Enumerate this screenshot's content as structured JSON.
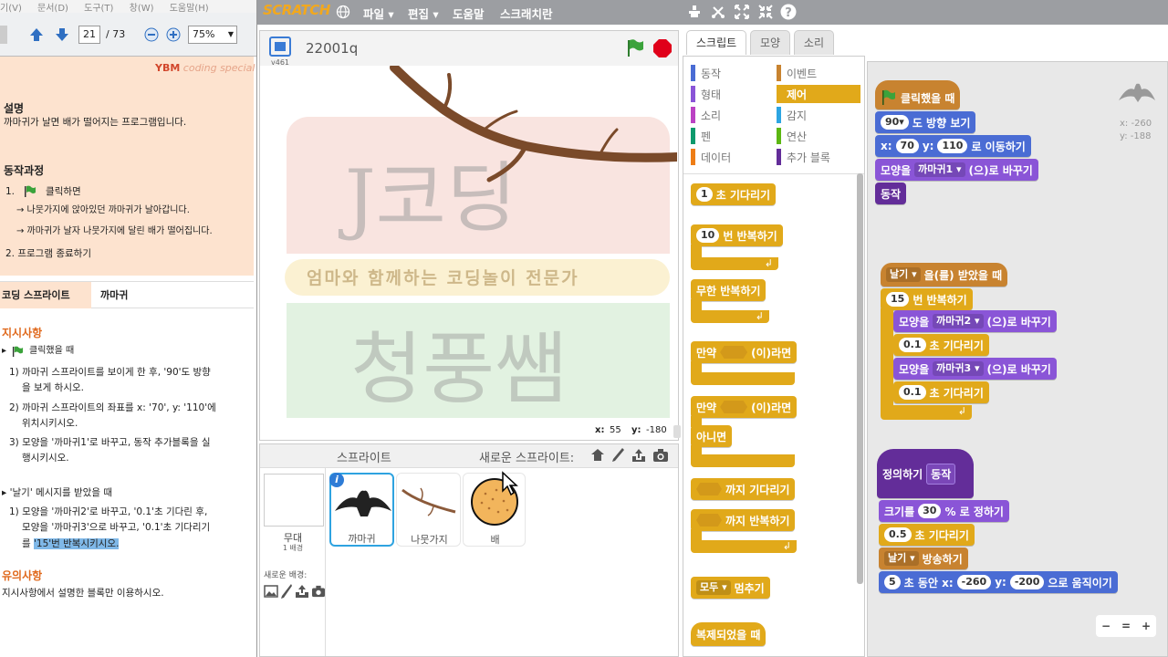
{
  "pdf": {
    "menu": [
      "기(V)",
      "문서(D)",
      "도구(T)",
      "창(W)",
      "도움말(H)"
    ],
    "page_current": "21",
    "page_total": "/ 73",
    "zoom": "75%",
    "logo_text": "coding special",
    "desc_title": "설명",
    "desc_text": "까마귀가 날면 배가 떨어지는 프로그램입니다.",
    "process_title": "동작과정",
    "step1_num": "1.",
    "step1_label": "클릭하면",
    "step1_a": "→ 나뭇가지에 앉아있던 까마귀가 날아갑니다.",
    "step1_b": "→ 까마귀가 날자 나뭇가지에 달린 배가 떨어집니다.",
    "step2": "2. 프로그램 종료하기",
    "table_left": "코딩 스프라이트",
    "table_right": "까마귀",
    "instr_title": "지시사항",
    "instr_when": "클릭했을 때",
    "instr_1a": "1) 까마귀 스프라이트를 보이게 한 후, '90'도 방향",
    "instr_1b": "을 보게 하시오.",
    "instr_2a": "2) 까마귀 스프라이트의 좌표를 x: '70', y: '110'에",
    "instr_2b": "위치시키시오.",
    "instr_3a": "3) 모양을 '까마귀1'로 바꾸고, 동작 추가블록을 실",
    "instr_3b": "행시키시오.",
    "msg_title": "▸ '날기' 메시지를 받았을 때",
    "msg_1a": "1) 모양을 '까마귀2'로 바꾸고, '0.1'초 기다린 후,",
    "msg_1b": "모양을 '까마귀3'으로 바꾸고, '0.1'초 기다리기",
    "msg_1c_pre": "를 ",
    "msg_1c_hl": "'15'번 반복시키시오.",
    "note_title": "유의사항",
    "note_text": "지시사항에서 설명한 블록만 이용하시오."
  },
  "scratch": {
    "logo": "SCRATCH",
    "menus": [
      "파일 ▾",
      "편집 ▾",
      "도움말",
      "스크래치란"
    ],
    "version": "v461",
    "project_title": "22001q",
    "stage_coords_x_label": "x:",
    "stage_coords_x": "55",
    "stage_coords_y_label": "y:",
    "stage_coords_y": "-180",
    "watermark_banner": "엄마와 함께하는 코딩놀이 전문가",
    "watermark_big1": "J코딩",
    "watermark_big2": "청풍쌤",
    "sprites_label": "스프라이트",
    "new_sprite_label": "새로운 스프라이트:",
    "backdrop_name": "무대",
    "backdrop_count": "1 배경",
    "new_backdrop_label": "새로운 배경:",
    "sprites": [
      {
        "name": "까마귀"
      },
      {
        "name": "나뭇가지"
      },
      {
        "name": "배"
      }
    ],
    "tabs": [
      "스크립트",
      "모양",
      "소리"
    ],
    "categories_left": [
      "동작",
      "형태",
      "소리",
      "펜",
      "데이터"
    ],
    "categories_right": [
      "이벤트",
      "제어",
      "감지",
      "연산",
      "추가 블록"
    ],
    "colors": {
      "motion": "#4a6cd4",
      "looks": "#8a55d7",
      "sound": "#bb42c3",
      "pen": "#0e9a6c",
      "data": "#ee7d16",
      "events": "#c88330",
      "control": "#e1a91a",
      "sensing": "#2ca5e2",
      "operators": "#5cb712",
      "more": "#632d99"
    },
    "palette": {
      "wait": "초 기다리기",
      "wait_val": "1",
      "repeat": "번 반복하기",
      "repeat_val": "10",
      "forever": "무한 반복하기",
      "if": "만약",
      "if_then": "(이)라면",
      "if2": "만약",
      "if2_then": "(이)라면",
      "else": "아니면",
      "wait_until": "까지 기다리기",
      "repeat_until": "까지 반복하기",
      "stop": "모두 ▾",
      "stop_label": "멈추기",
      "clone": "복제되었을 때"
    },
    "script_coords_x": "x: -260",
    "script_coords_y": "y: -188",
    "script1": {
      "hat": "클릭했을 때",
      "dir_val": "90▾",
      "dir_label": "도 방향 보기",
      "goto_x_label": "x:",
      "goto_x": "70",
      "goto_y_label": "y:",
      "goto_y": "110",
      "goto_label": "로 이동하기",
      "costume_pre": "모양을",
      "costume_val": "까마귀1 ▾",
      "costume_post": "(으)로 바꾸기",
      "call": "동작"
    },
    "script2": {
      "hat_val": "날기 ▾",
      "hat_label": "을(를) 받았을 때",
      "repeat_val": "15",
      "repeat_label": "번 반복하기",
      "c1_pre": "모양을",
      "c1_val": "까마귀2 ▾",
      "c1_post": "(으)로 바꾸기",
      "w1_val": "0.1",
      "w1_label": "초 기다리기",
      "c2_pre": "모양을",
      "c2_val": "까마귀3 ▾",
      "c2_post": "(으)로 바꾸기",
      "w2_val": "0.1",
      "w2_label": "초 기다리기"
    },
    "script3": {
      "define": "정의하기",
      "define_name": "동작",
      "size_pre": "크기를",
      "size_val": "30",
      "size_post": "% 로 정하기",
      "wait_val": "0.5",
      "wait_label": "초 기다리기",
      "bc_val": "날기 ▾",
      "bc_label": "방송하기",
      "glide_val": "5",
      "glide_mid": "초 동안 x:",
      "glide_x": "-260",
      "glide_y_label": "y:",
      "glide_y": "-200",
      "glide_post": "으로 움직이기"
    },
    "zoom_controls": [
      "−",
      "=",
      "+"
    ]
  }
}
